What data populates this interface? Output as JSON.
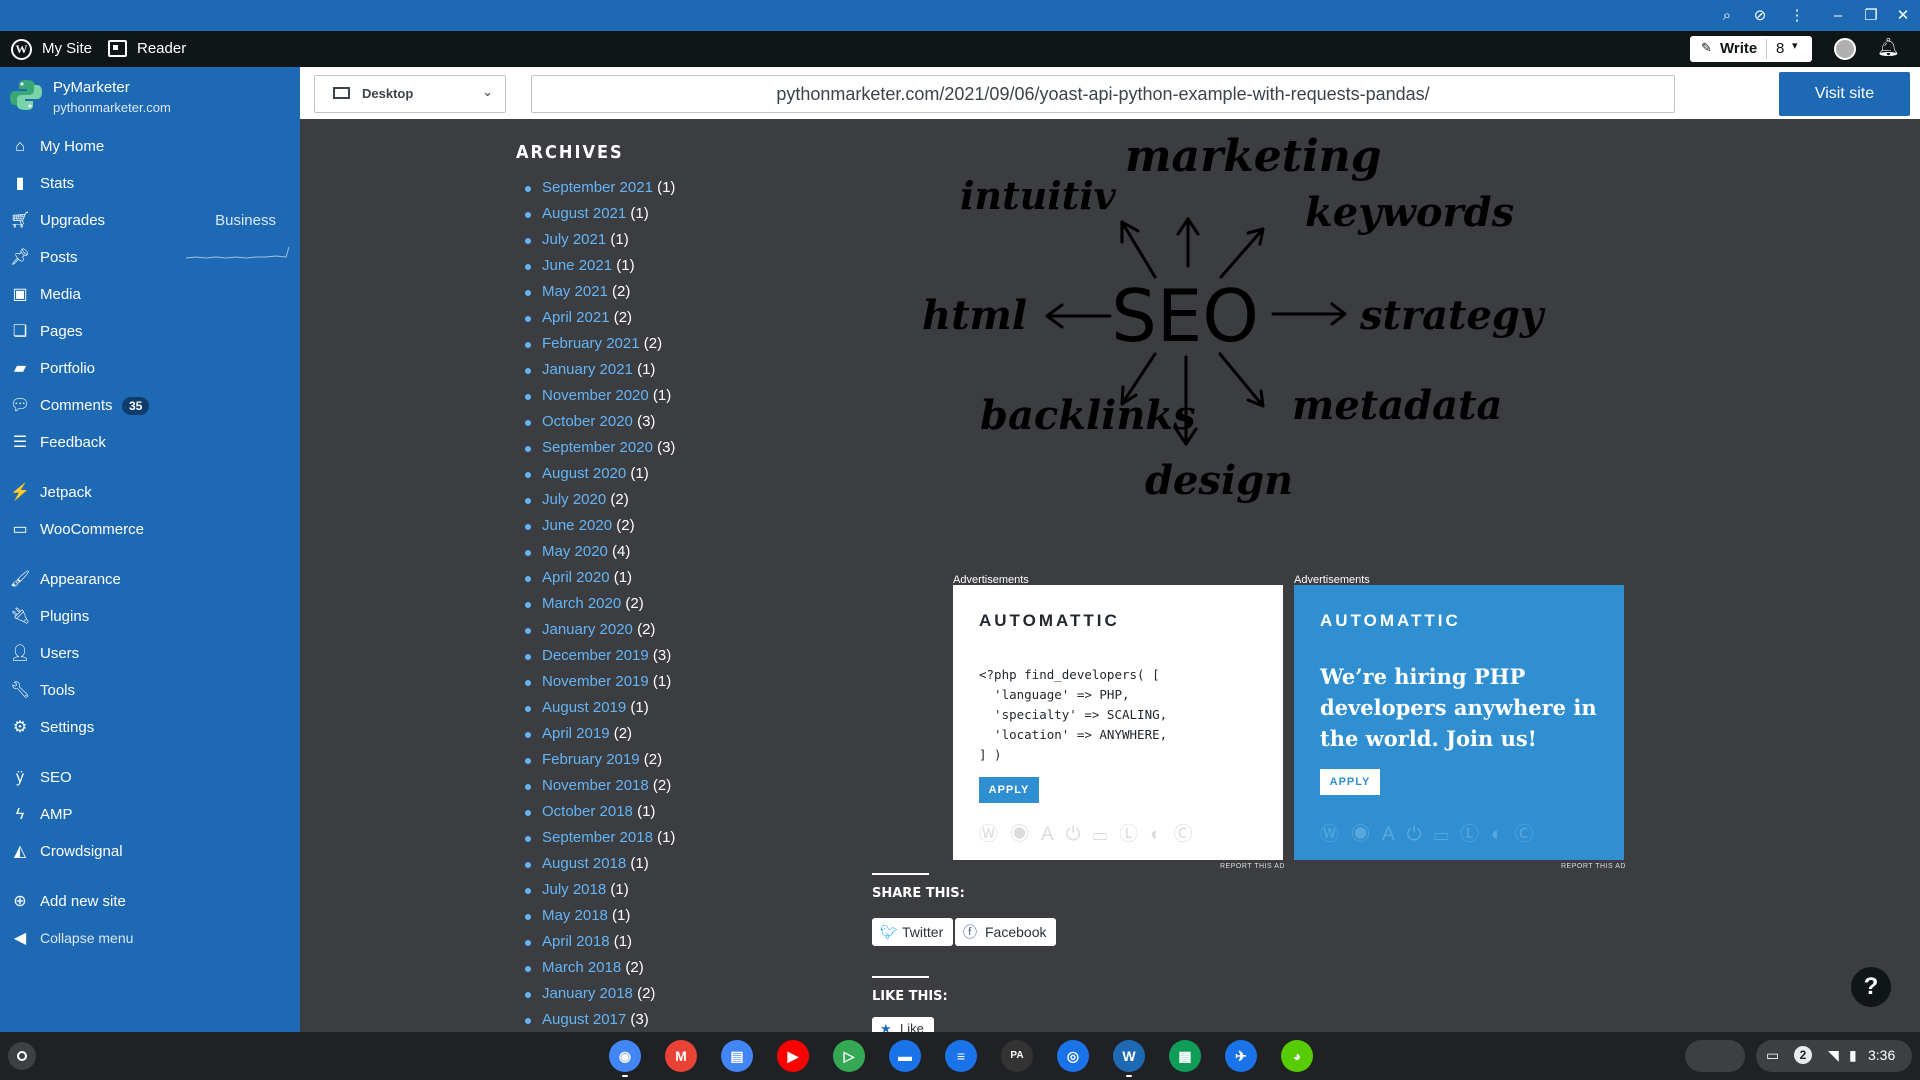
{
  "window_controls": [
    "zoom-icon",
    "eye-off-icon",
    "kebab-menu-icon",
    "minimize-icon",
    "restore-icon",
    "close-icon"
  ],
  "adminbar": {
    "my_site": "My Site",
    "reader": "Reader",
    "write": "Write",
    "write_count": "8"
  },
  "sidebar": {
    "site_name": "PyMarketer",
    "site_url": "pythonmarketer.com",
    "items": [
      {
        "icon": "home-icon",
        "label": "My Home"
      },
      {
        "icon": "stats-icon",
        "label": "Stats"
      },
      {
        "icon": "cart-icon",
        "label": "Upgrades",
        "extra": "Business"
      },
      {
        "icon": "pin-icon",
        "label": "Posts"
      },
      {
        "icon": "media-icon",
        "label": "Media"
      },
      {
        "icon": "pages-icon",
        "label": "Pages"
      },
      {
        "icon": "folder-icon",
        "label": "Portfolio"
      },
      {
        "icon": "comment-icon",
        "label": "Comments",
        "badge": "35"
      },
      {
        "icon": "feedback-icon",
        "label": "Feedback"
      },
      {
        "icon": "jetpack-icon",
        "label": "Jetpack"
      },
      {
        "icon": "woo-icon",
        "label": "WooCommerce"
      },
      {
        "icon": "brush-icon",
        "label": "Appearance"
      },
      {
        "icon": "plugin-icon",
        "label": "Plugins"
      },
      {
        "icon": "user-icon",
        "label": "Users"
      },
      {
        "icon": "wrench-icon",
        "label": "Tools"
      },
      {
        "icon": "settings-icon",
        "label": "Settings"
      },
      {
        "icon": "yoast-icon",
        "label": "SEO"
      },
      {
        "icon": "amp-icon",
        "label": "AMP"
      },
      {
        "icon": "crowdsignal-icon",
        "label": "Crowdsignal"
      },
      {
        "icon": "plus-circle-icon",
        "label": "Add new site"
      },
      {
        "icon": "collapse-icon",
        "label": "Collapse menu"
      }
    ]
  },
  "previewbar": {
    "device": "Desktop",
    "url": "pythonmarketer.com/2021/09/06/yoast-api-python-example-with-requests-pandas/",
    "visit_site": "Visit site"
  },
  "archives": {
    "title": "ARCHIVES",
    "entries": [
      {
        "month": "September 2021",
        "count": "(1)"
      },
      {
        "month": "August 2021",
        "count": "(1)"
      },
      {
        "month": "July 2021",
        "count": "(1)"
      },
      {
        "month": "June 2021",
        "count": "(1)"
      },
      {
        "month": "May 2021",
        "count": "(2)"
      },
      {
        "month": "April 2021",
        "count": "(2)"
      },
      {
        "month": "February 2021",
        "count": "(2)"
      },
      {
        "month": "January 2021",
        "count": "(1)"
      },
      {
        "month": "November 2020",
        "count": "(1)"
      },
      {
        "month": "October 2020",
        "count": "(3)"
      },
      {
        "month": "September 2020",
        "count": "(3)"
      },
      {
        "month": "August 2020",
        "count": "(1)"
      },
      {
        "month": "July 2020",
        "count": "(2)"
      },
      {
        "month": "June 2020",
        "count": "(2)"
      },
      {
        "month": "May 2020",
        "count": "(4)"
      },
      {
        "month": "April 2020",
        "count": "(1)"
      },
      {
        "month": "March 2020",
        "count": "(2)"
      },
      {
        "month": "January 2020",
        "count": "(2)"
      },
      {
        "month": "December 2019",
        "count": "(3)"
      },
      {
        "month": "November 2019",
        "count": "(1)"
      },
      {
        "month": "August 2019",
        "count": "(1)"
      },
      {
        "month": "April 2019",
        "count": "(2)"
      },
      {
        "month": "February 2019",
        "count": "(2)"
      },
      {
        "month": "November 2018",
        "count": "(2)"
      },
      {
        "month": "October 2018",
        "count": "(1)"
      },
      {
        "month": "September 2018",
        "count": "(1)"
      },
      {
        "month": "August 2018",
        "count": "(1)"
      },
      {
        "month": "July 2018",
        "count": "(1)"
      },
      {
        "month": "May 2018",
        "count": "(1)"
      },
      {
        "month": "April 2018",
        "count": "(1)"
      },
      {
        "month": "March 2018",
        "count": "(2)"
      },
      {
        "month": "January 2018",
        "count": "(2)"
      },
      {
        "month": "August 2017",
        "count": "(3)"
      }
    ]
  },
  "seo_image": {
    "center": "SEO",
    "words": [
      "marketing",
      "intuitiv",
      "keywords",
      "html",
      "strategy",
      "backlinks",
      "metadata",
      "design"
    ]
  },
  "ads": {
    "label": "Advertisements",
    "logo": "AUTOMATTIC",
    "code": "<?php find_developers( [\n  'language' => PHP,\n  'specialty' => SCALING,\n  'location' => ANYWHERE,\n] )",
    "hiring_text": "We’re hiring PHP developers anywhere in the world. Join us!",
    "apply": "APPLY",
    "report": "REPORT THIS AD"
  },
  "share": {
    "heading": "SHARE THIS:",
    "twitter": "Twitter",
    "facebook": "Facebook",
    "like_heading": "LIKE THIS:",
    "like": "Like"
  },
  "help": "?",
  "shelf": {
    "apps": [
      {
        "name": "chrome-icon",
        "color": "#4285f4",
        "glyph": "◉"
      },
      {
        "name": "gmail-icon",
        "color": "#ea4335",
        "glyph": "M"
      },
      {
        "name": "docs-icon",
        "color": "#4285f4",
        "glyph": "▤"
      },
      {
        "name": "youtube-icon",
        "color": "#ff0000",
        "glyph": "▶"
      },
      {
        "name": "play-store-icon",
        "color": "#34a853",
        "glyph": "▷"
      },
      {
        "name": "files-icon",
        "color": "#1a73e8",
        "glyph": "▬"
      },
      {
        "name": "messages-icon",
        "color": "#1a73e8",
        "glyph": "≡"
      },
      {
        "name": "code-pad-icon",
        "color": "#333333",
        "glyph": "PA"
      },
      {
        "name": "camera-icon",
        "color": "#1a73e8",
        "glyph": "◎"
      },
      {
        "name": "wordpress-icon",
        "color": "#1d69b3",
        "glyph": "W"
      },
      {
        "name": "sheets-icon",
        "color": "#0f9d58",
        "glyph": "▦"
      },
      {
        "name": "messenger-icon",
        "color": "#1a73e8",
        "glyph": "✈"
      },
      {
        "name": "duolingo-icon",
        "color": "#58cc02",
        "glyph": "◕"
      }
    ],
    "notification_count": "2",
    "time": "3:36"
  }
}
